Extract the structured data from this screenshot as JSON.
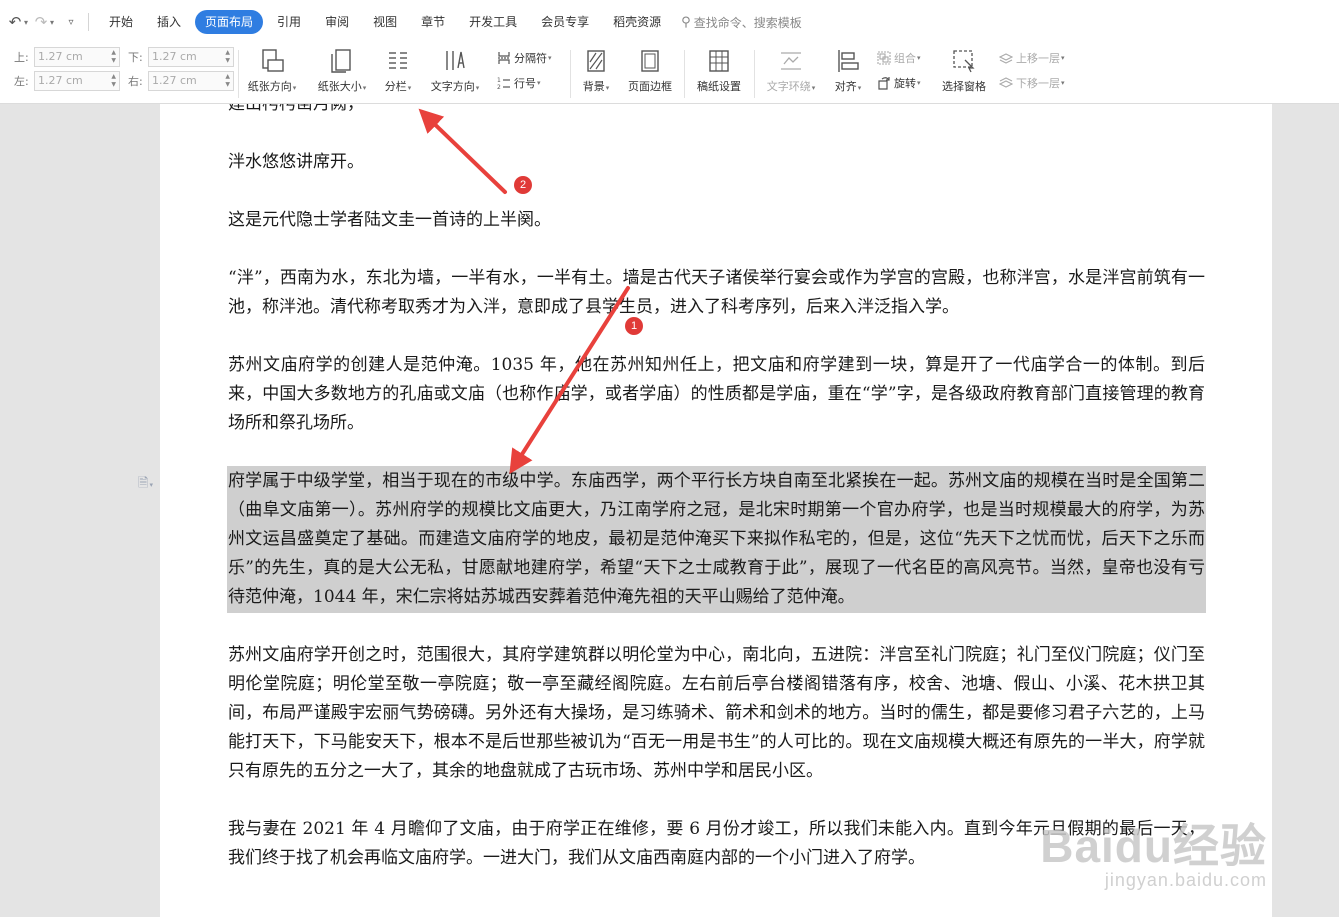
{
  "menubar": {
    "items": [
      "开始",
      "插入",
      "页面布局",
      "引用",
      "审阅",
      "视图",
      "章节",
      "开发工具",
      "会员专享",
      "稻壳资源"
    ],
    "active_index": 2,
    "search_placeholder": "查找命令、搜索模板"
  },
  "ribbon": {
    "margins": {
      "top_label": "上:",
      "top_value": "1.27 cm",
      "bottom_label": "下:",
      "bottom_value": "1.27 cm",
      "left_label": "左:",
      "left_value": "1.27 cm",
      "right_label": "右:",
      "right_value": "1.27 cm"
    },
    "orientation": "纸张方向",
    "size": "纸张大小",
    "columns": "分栏",
    "text_direction": "文字方向",
    "separator": "分隔符",
    "line_number": "行号",
    "background": "背景",
    "page_border": "页面边框",
    "paper_settings": "稿纸设置",
    "text_wrap": "文字环绕",
    "align": "对齐",
    "group": "组合",
    "rotate": "旋转",
    "selection_pane": "选择窗格",
    "bring_forward": "上移一层",
    "send_backward": "下移一层"
  },
  "document": {
    "paragraphs": [
      {
        "text": "建山枵枵凿月阙，",
        "selected": false
      },
      {
        "text": "泮水悠悠讲席开。",
        "selected": false
      },
      {
        "text": "这是元代隐士学者陆文圭一首诗的上半阕。",
        "selected": false
      },
      {
        "text": "“泮”，西南为水，东北为墙，一半有水，一半有土。墙是古代天子诸侯举行宴会或作为学宫的宫殿，也称泮宫，水是泮宫前筑有一池，称泮池。清代称考取秀才为入泮，意即成了县学生员，进入了科考序列，后来入泮泛指入学。",
        "selected": false
      },
      {
        "text": "苏州文庙府学的创建人是范仲淹。1035 年，他在苏州知州任上，把文庙和府学建到一块，算是开了一代庙学合一的体制。到后来，中国大多数地方的孔庙或文庙（也称作庙学，或者学庙）的性质都是学庙，重在“学”字，是各级政府教育部门直接管理的教育场所和祭孔场所。",
        "selected": false
      },
      {
        "text": "府学属于中级学堂，相当于现在的市级中学。东庙西学，两个平行长方块自南至北紧挨在一起。苏州文庙的规模在当时是全国第二（曲阜文庙第一）。苏州府学的规模比文庙更大，乃江南学府之冠，是北宋时期第一个官办府学，也是当时规模最大的府学，为苏州文运昌盛奠定了基础。而建造文庙府学的地皮，最初是范仲淹买下来拟作私宅的，但是，这位“先天下之忧而忧，后天下之乐而乐”的先生，真的是大公无私，甘愿献地建府学，希望“天下之士咸教育于此”，展现了一代名臣的高风亮节。当然，皇帝也没有亏待范仲淹，1044 年，宋仁宗将姑苏城西安葬着范仲淹先祖的天平山赐给了范仲淹。",
        "selected": true
      },
      {
        "text": "苏州文庙府学开创之时，范围很大，其府学建筑群以明伦堂为中心，南北向，五进院：泮宫至礼门院庭；礼门至仪门院庭；仪门至明伦堂院庭；明伦堂至敬一亭院庭；敬一亭至藏经阁院庭。左右前后亭台楼阁错落有序，校舍、池塘、假山、小溪、花木拱卫其间，布局严谨殿宇宏丽气势磅礴。另外还有大操场，是习练骑术、箭术和剑术的地方。当时的儒生，都是要修习君子六艺的，上马能打天下，下马能安天下，根本不是后世那些被讥为“百无一用是书生”的人可比的。现在文庙规模大概还有原先的一半大，府学就只有原先的五分之一大了，其余的地盘就成了古玩市场、苏州中学和居民小区。",
        "selected": false
      },
      {
        "text": "我与妻在 2021 年 4 月瞻仰了文庙，由于府学正在维修，要 6 月份才竣工，所以我们未能入内。直到今年元旦假期的最后一天，我们终于找了机会再临文庙府学。一进大门，我们从文庙西南庭内部的一个小门进入了府学。",
        "selected": false
      }
    ]
  },
  "annotations": {
    "badge_1": "1",
    "badge_2": "2",
    "arrow_color": "#e8413c"
  },
  "watermark": {
    "logo": "Baidu经验",
    "url": "jingyan.baidu.com"
  },
  "colors": {
    "accent": "#2f7de1",
    "selection": "#cfcfcf",
    "page_bg": "#e4e4e4"
  }
}
